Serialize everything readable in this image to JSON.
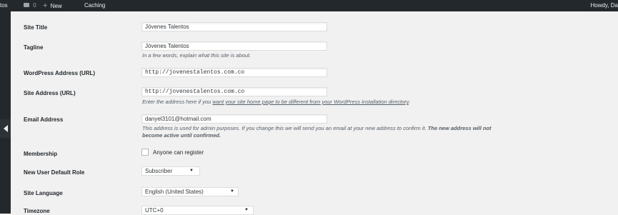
{
  "admin_bar": {
    "site_name_fragment": "tos",
    "comments_count": "0",
    "new_label": "New",
    "caching_label": "Caching",
    "greeting_fragment": "Howdy, Da"
  },
  "settings": {
    "site_title": {
      "label": "Site Title",
      "value": "Jóvenes Talentos"
    },
    "tagline": {
      "label": "Tagline",
      "value": "Jóvenes Talentos",
      "description": "In a few words, explain what this site is about."
    },
    "wordpress_address": {
      "label": "WordPress Address (URL)",
      "value": "http://jovenestalentos.com.co"
    },
    "site_address": {
      "label": "Site Address (URL)",
      "value": "http://jovenestalentos.com.co",
      "description_prefix": "Enter the address here if you ",
      "description_link": "want your site home page to be different from your WordPress installation directory",
      "description_suffix": "."
    },
    "email_address": {
      "label": "Email Address",
      "value": "danyel3101@hotmail.com",
      "description_part1": "This address is used for admin purposes. If you change this we will send you an email at your new address to confirm it. ",
      "description_bold1": "The new address will not",
      "description_bold2": "become active until confirmed."
    },
    "membership": {
      "label": "Membership",
      "checkbox_label": "Anyone can register",
      "checked": false
    },
    "default_role": {
      "label": "New User Default Role",
      "selected": "Subscriber"
    },
    "site_language": {
      "label": "Site Language",
      "selected": "English (United States)"
    },
    "timezone": {
      "label": "Timezone",
      "selected": "UTC+0"
    }
  }
}
